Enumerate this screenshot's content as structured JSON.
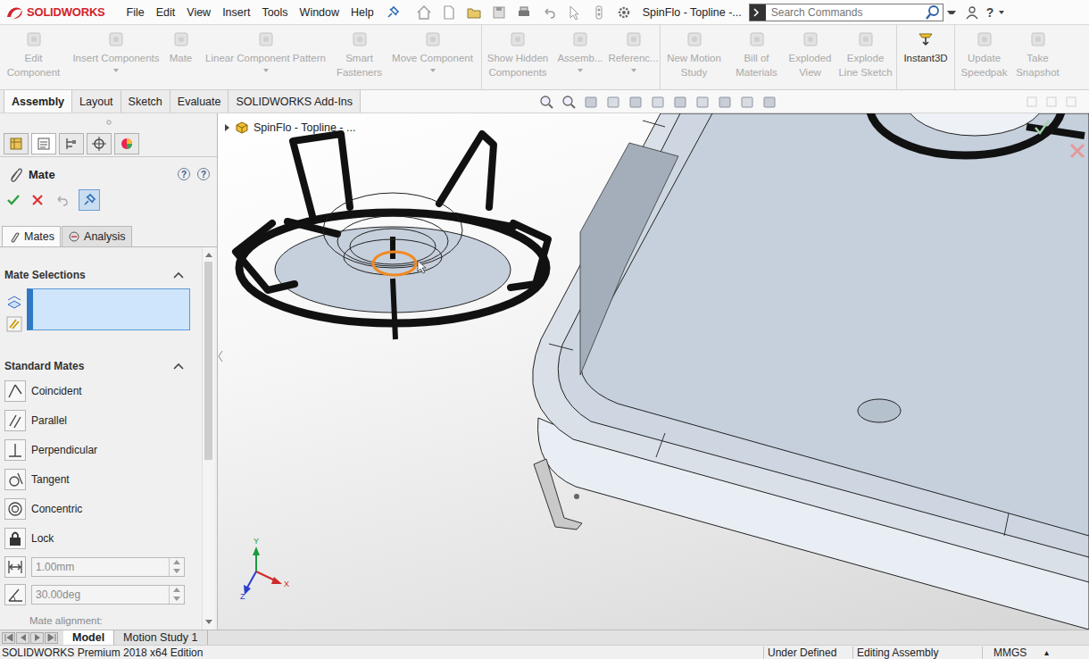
{
  "app": {
    "logo": "SOLIDWORKS",
    "menu": [
      "File",
      "Edit",
      "View",
      "Insert",
      "Tools",
      "Window",
      "Help"
    ],
    "title": "SpinFlo - Topline -...",
    "search": {
      "placeholder": "Search Commands"
    },
    "help": "?"
  },
  "ribbon": [
    {
      "label": "Edit Component",
      "disabled": true,
      "dropdown": false
    },
    {
      "label": "Insert Components",
      "disabled": true,
      "dropdown": true
    },
    {
      "label": "Mate",
      "disabled": true,
      "dropdown": false
    },
    {
      "label": "Linear Component Pattern",
      "disabled": true,
      "dropdown": true
    },
    {
      "label": "Smart Fasteners",
      "disabled": true,
      "dropdown": false
    },
    {
      "label": "Move Component",
      "disabled": true,
      "dropdown": true
    },
    {
      "label": "Show Hidden Components",
      "disabled": true,
      "dropdown": false
    },
    {
      "label": "Assemb...",
      "disabled": true,
      "dropdown": true
    },
    {
      "label": "Referenc...",
      "disabled": true,
      "dropdown": true
    },
    {
      "label": "New Motion Study",
      "disabled": true,
      "dropdown": false
    },
    {
      "label": "Bill of Materials",
      "disabled": true,
      "dropdown": false
    },
    {
      "label": "Exploded View",
      "disabled": true,
      "dropdown": false
    },
    {
      "label": "Explode Line Sketch",
      "disabled": true,
      "dropdown": false
    },
    {
      "label": "Instant3D",
      "disabled": false,
      "dropdown": false
    },
    {
      "label": "Update Speedpak",
      "disabled": true,
      "dropdown": false
    },
    {
      "label": "Take Snapshot",
      "disabled": true,
      "dropdown": false
    }
  ],
  "tabs": [
    {
      "label": "Assembly",
      "selected": true
    },
    {
      "label": "Layout",
      "selected": false
    },
    {
      "label": "Sketch",
      "selected": false
    },
    {
      "label": "Evaluate",
      "selected": false
    },
    {
      "label": "SOLIDWORKS Add-Ins",
      "selected": false
    }
  ],
  "tree": {
    "root": "SpinFlo - Topline - ...",
    "expanded": false
  },
  "property_manager": {
    "title": "Mate",
    "help": "?",
    "pinned": true,
    "sub_tabs": [
      {
        "label": "Mates",
        "selected": true
      },
      {
        "label": "Analysis",
        "selected": false
      }
    ],
    "mate_selections": {
      "title": "Mate Selections",
      "expanded": true,
      "focused": true
    },
    "standard_mates": {
      "title": "Standard Mates",
      "expanded": true,
      "items": [
        {
          "label": "Coincident",
          "selected": false
        },
        {
          "label": "Parallel",
          "selected": false
        },
        {
          "label": "Perpendicular",
          "selected": false
        },
        {
          "label": "Tangent",
          "selected": false
        },
        {
          "label": "Concentric",
          "selected": false
        },
        {
          "label": "Lock",
          "selected": false
        }
      ]
    },
    "distance": "1.00mm",
    "angle": "30.00deg",
    "alignment_label": "Mate alignment:"
  },
  "axes": {
    "x": "X",
    "y": "Y",
    "z": "Z"
  },
  "bottom_tabs": [
    {
      "label": "Model",
      "selected": true
    },
    {
      "label": "Motion Study 1",
      "selected": false
    }
  ],
  "status_bar": {
    "edition": "SOLIDWORKS Premium 2018 x64 Edition",
    "status": "Under Defined",
    "mode": "Editing Assembly",
    "units": "MMGS",
    "units_arrow": "▴"
  }
}
